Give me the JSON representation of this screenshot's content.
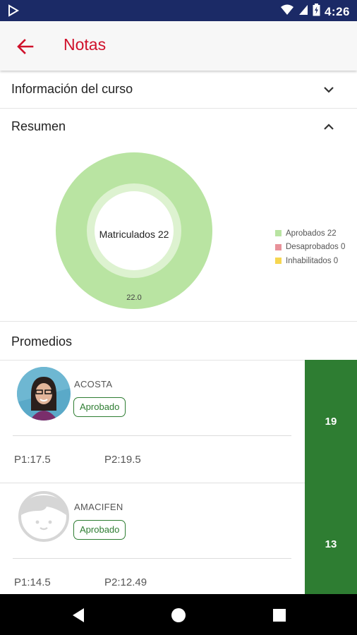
{
  "status_bar": {
    "time": "4:26"
  },
  "app_bar": {
    "title": "Notas"
  },
  "sections": {
    "course_info": "Información del curso",
    "summary": "Resumen",
    "averages": "Promedios"
  },
  "summary_chart": {
    "center_label": "Matriculados 22",
    "value_label": "22.0"
  },
  "chart_data": {
    "type": "pie",
    "title": "",
    "center_text": "Matriculados 22",
    "categories": [
      "Aprobados",
      "Desaprobados",
      "Inhabilitados"
    ],
    "values": [
      22,
      0,
      0
    ],
    "data_labels": [
      "22.0"
    ],
    "legend_position": "right",
    "legend": [
      {
        "label": "Aprobados 22",
        "color": "#b9e4a2"
      },
      {
        "label": "Desaprobados 0",
        "color": "#e8929a"
      },
      {
        "label": "Inhabilitados 0",
        "color": "#f6d650"
      }
    ]
  },
  "students": [
    {
      "name": "ACOSTA",
      "status": "Aprobado",
      "p1": "P1:17.5",
      "p2": "P2:19.5",
      "grade": "19",
      "avatar": "photo"
    },
    {
      "name": "AMACIFEN",
      "status": "Aprobado",
      "p1": "P1:14.5",
      "p2": "P2:12.49",
      "grade": "13",
      "avatar": "placeholder"
    }
  ],
  "colors": {
    "status_bar": "#1b2a66",
    "accent": "#d0112b",
    "grade_green": "#2e7d32",
    "donut_green": "#b9e4a2"
  }
}
